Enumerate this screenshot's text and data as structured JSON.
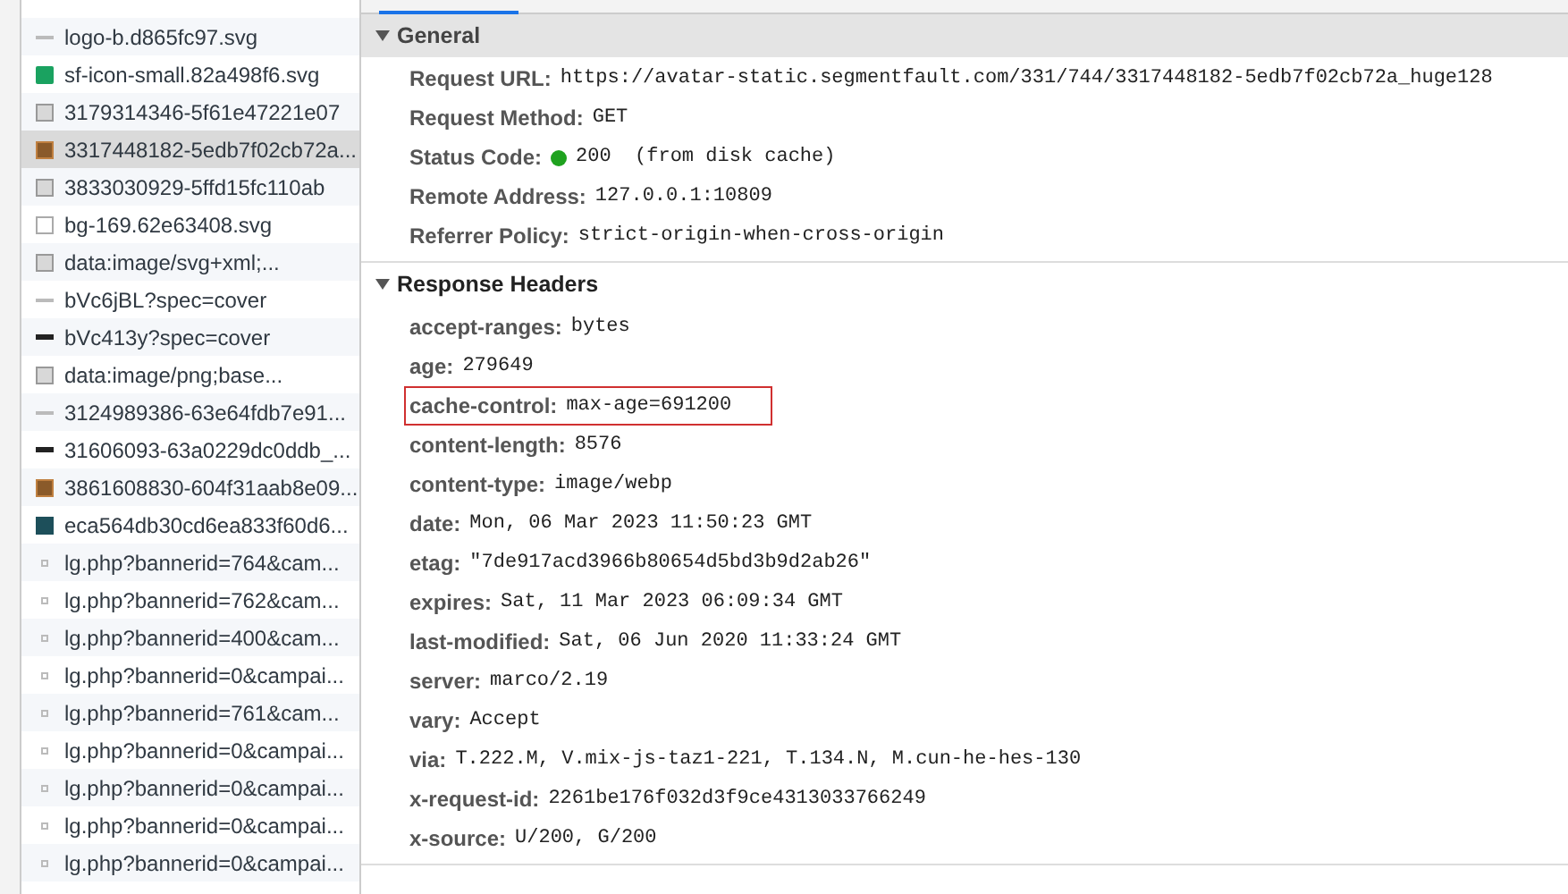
{
  "requests": [
    {
      "name": "logo-b.d865fc97.svg",
      "kind": "svg",
      "selected": false
    },
    {
      "name": "sf-icon-small.82a498f6.svg",
      "kind": "logo",
      "selected": false
    },
    {
      "name": "3179314346-5f61e47221e07",
      "kind": "image",
      "selected": false
    },
    {
      "name": "3317448182-5edb7f02cb72a...",
      "kind": "photo",
      "selected": true
    },
    {
      "name": "3833030929-5ffd15fc110ab",
      "kind": "image",
      "selected": false
    },
    {
      "name": "bg-169.62e63408.svg",
      "kind": "blank",
      "selected": false
    },
    {
      "name": "data:image/svg+xml;...",
      "kind": "image",
      "selected": false
    },
    {
      "name": "bVc6jBL?spec=cover",
      "kind": "svg",
      "selected": false
    },
    {
      "name": "bVc413y?spec=cover",
      "kind": "dark",
      "selected": false
    },
    {
      "name": "data:image/png;base...",
      "kind": "image",
      "selected": false
    },
    {
      "name": "3124989386-63e64fdb7e91...",
      "kind": "svg",
      "selected": false
    },
    {
      "name": "31606093-63a0229dc0ddb_...",
      "kind": "dark",
      "selected": false
    },
    {
      "name": "3861608830-604f31aab8e09...",
      "kind": "photo",
      "selected": false
    },
    {
      "name": "eca564db30cd6ea833f60d6...",
      "kind": "teal",
      "selected": false
    },
    {
      "name": "lg.php?bannerid=764&cam...",
      "kind": "dot",
      "selected": false
    },
    {
      "name": "lg.php?bannerid=762&cam...",
      "kind": "dot",
      "selected": false
    },
    {
      "name": "lg.php?bannerid=400&cam...",
      "kind": "dot",
      "selected": false
    },
    {
      "name": "lg.php?bannerid=0&campai...",
      "kind": "dot",
      "selected": false
    },
    {
      "name": "lg.php?bannerid=761&cam...",
      "kind": "dot",
      "selected": false
    },
    {
      "name": "lg.php?bannerid=0&campai...",
      "kind": "dot",
      "selected": false
    },
    {
      "name": "lg.php?bannerid=0&campai...",
      "kind": "dot",
      "selected": false
    },
    {
      "name": "lg.php?bannerid=0&campai...",
      "kind": "dot",
      "selected": false
    },
    {
      "name": "lg.php?bannerid=0&campai...",
      "kind": "dot",
      "selected": false
    }
  ],
  "sections": [
    {
      "title": "General",
      "expanded": true,
      "shaded": true,
      "rows": [
        {
          "key": "Request URL:",
          "value": "https://avatar-static.segmentfault.com/331/744/3317448182-5edb7f02cb72a_huge128",
          "highlighted": false
        },
        {
          "key": "Request Method:",
          "value": "GET",
          "highlighted": false
        },
        {
          "key": "Status Code:",
          "value": "200  (from disk cache)",
          "success": true,
          "highlighted": false
        },
        {
          "key": "Remote Address:",
          "value": "127.0.0.1:10809",
          "highlighted": false
        },
        {
          "key": "Referrer Policy:",
          "value": "strict-origin-when-cross-origin",
          "highlighted": false
        }
      ]
    },
    {
      "title": "Response Headers",
      "expanded": true,
      "shaded": false,
      "rows": [
        {
          "key": "accept-ranges:",
          "value": "bytes",
          "highlighted": false
        },
        {
          "key": "age:",
          "value": "279649",
          "highlighted": false
        },
        {
          "key": "cache-control:",
          "value": "max-age=691200",
          "highlighted": true
        },
        {
          "key": "content-length:",
          "value": "8576",
          "highlighted": false
        },
        {
          "key": "content-type:",
          "value": "image/webp",
          "highlighted": false
        },
        {
          "key": "date:",
          "value": "Mon, 06 Mar 2023 11:50:23 GMT",
          "highlighted": false
        },
        {
          "key": "etag:",
          "value": "\"7de917acd3966b80654d5bd3b9d2ab26\"",
          "highlighted": false
        },
        {
          "key": "expires:",
          "value": "Sat, 11 Mar 2023 06:09:34 GMT",
          "highlighted": false
        },
        {
          "key": "last-modified:",
          "value": "Sat, 06 Jun 2020 11:33:24 GMT",
          "highlighted": false
        },
        {
          "key": "server:",
          "value": "marco/2.19",
          "highlighted": false
        },
        {
          "key": "vary:",
          "value": "Accept",
          "highlighted": false
        },
        {
          "key": "via:",
          "value": "T.222.M, V.mix-js-taz1-221, T.134.N, M.cun-he-hes-130",
          "highlighted": false
        },
        {
          "key": "x-request-id:",
          "value": "2261be176f032d3f9ce4313033766249",
          "highlighted": false
        },
        {
          "key": "x-source:",
          "value": "U/200, G/200",
          "highlighted": false
        }
      ]
    }
  ]
}
